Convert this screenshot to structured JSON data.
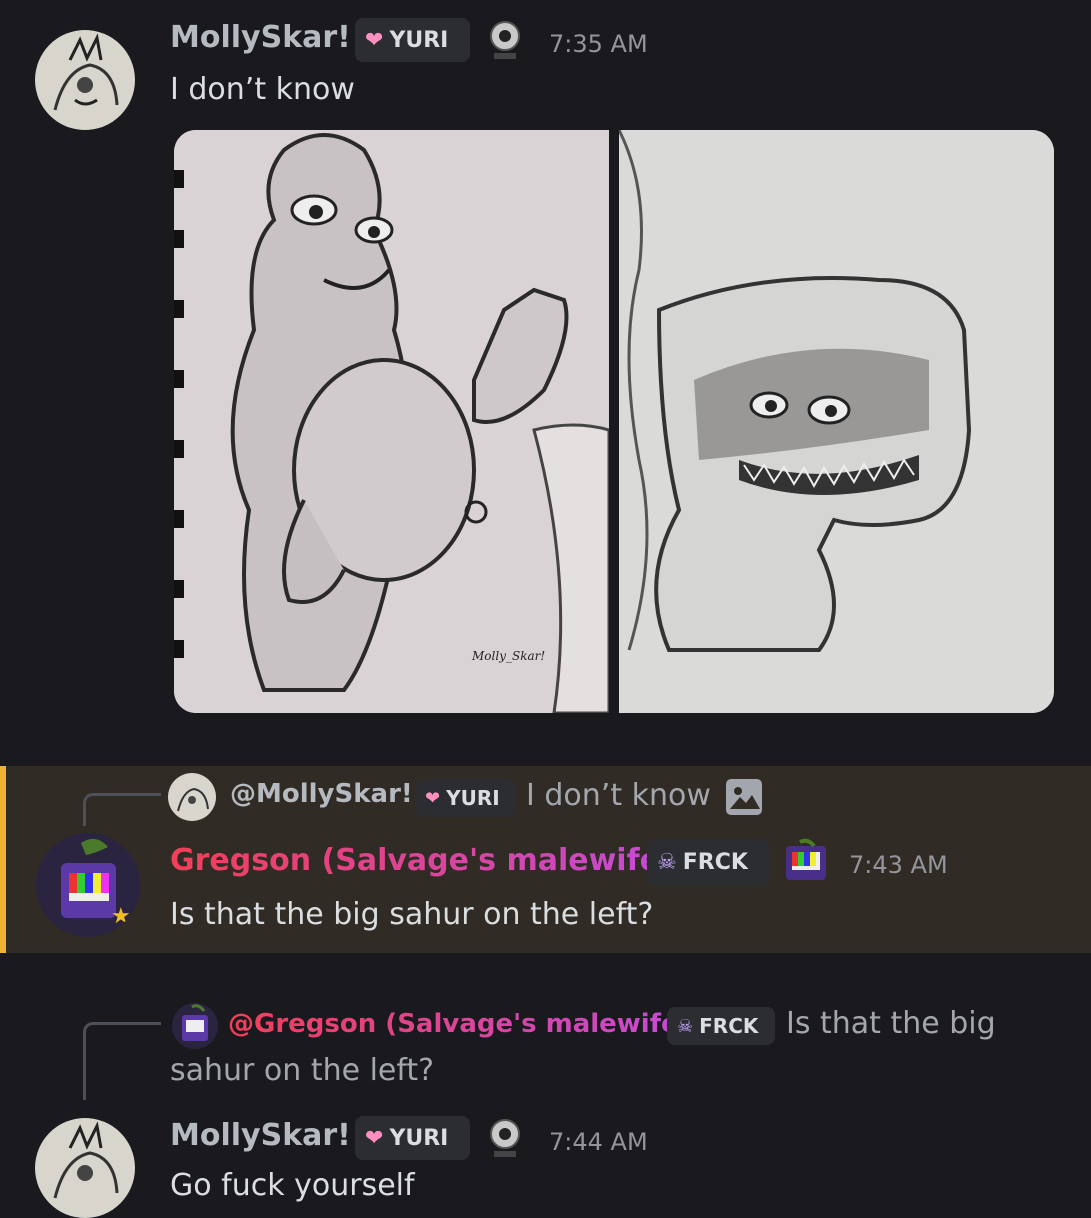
{
  "messages": [
    {
      "author": "MollySkar!",
      "author_color": "#b5bac1",
      "role_tag": "YURI",
      "role_icon": "heart-icon",
      "timestamp": "7:35 AM",
      "text": "I don’t know",
      "attachments": [
        {
          "type": "image",
          "signature": "Molly_Skar!"
        },
        {
          "type": "image"
        }
      ]
    },
    {
      "reply": {
        "author": "@MollySkar!",
        "role_tag": "YURI",
        "text": "I don’t know",
        "attachment_icon": "image-icon"
      },
      "author": "Gregson (Salvage's malewife)",
      "author_gradient": [
        "#f23f58",
        "#c44bd8"
      ],
      "role_tag": "FRCK",
      "role_icon": "skull-icon",
      "timestamp": "7:43 AM",
      "text": "Is that the big sahur on the left?",
      "highlighted": true
    },
    {
      "reply": {
        "author": "@Gregson (Salvage's malewife)",
        "role_tag": "FRCK",
        "text_line1": "Is that the big",
        "text_line2": "sahur on the left?"
      },
      "author": "MollySkar!",
      "role_tag": "YURI",
      "timestamp": "7:44 AM",
      "text": "Go fuck yourself"
    }
  ],
  "colors": {
    "background": "#1a1a1e",
    "highlight_bg": "#302b25",
    "highlight_bar": "#f0b232",
    "tag_bg": "#2b2d31"
  }
}
